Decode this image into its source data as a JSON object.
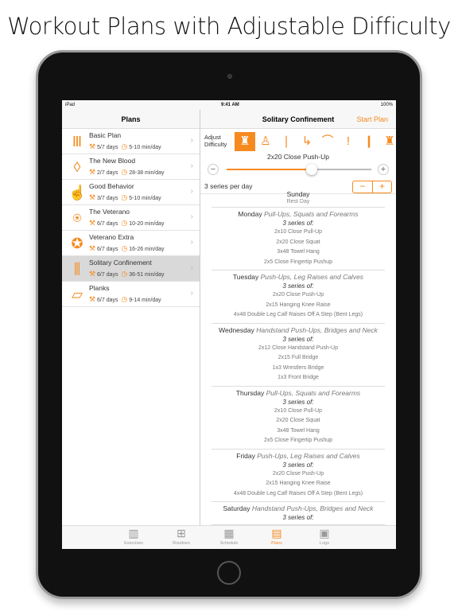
{
  "headline": "Workout Plans with Adjustable Difficulty",
  "status": {
    "device": "iPad",
    "time": "9:41 AM",
    "battery": "100%"
  },
  "left": {
    "title": "Plans",
    "plans": [
      {
        "name": "Basic Plan",
        "days": "5/7 days",
        "time": "5-10 min/day",
        "icon": "column-icon"
      },
      {
        "name": "The New Blood",
        "days": "2/7 days",
        "time": "28-38 min/day",
        "icon": "drop-icon"
      },
      {
        "name": "Good Behavior",
        "days": "3/7 days",
        "time": "5-10 min/day",
        "icon": "thumbs-up-icon"
      },
      {
        "name": "The Veterano",
        "days": "6/7 days",
        "time": "10-20 min/day",
        "icon": "medal-icon"
      },
      {
        "name": "Veterano Extra",
        "days": "6/7 days",
        "time": "16-26 min/day",
        "icon": "medal-stars-icon"
      },
      {
        "name": "Solitary Confinement",
        "days": "6/7 days",
        "time": "36-51 min/day",
        "icon": "bars-icon",
        "selected": true
      },
      {
        "name": "Planks",
        "days": "6/7 days",
        "time": "9-14 min/day",
        "icon": "plank-icon"
      }
    ]
  },
  "right": {
    "title": "Solitary Confinement",
    "start": "Start Plan",
    "adjust": "Adjust Difficulty",
    "exercise": "2x20 Close Push-Up",
    "slider_value": 0.59,
    "series": "3 series per day",
    "minus": "−",
    "plus": "+",
    "schedule": [
      {
        "day": "Sunday",
        "rest": "Rest Day"
      },
      {
        "day": "Monday",
        "focus": "Pull-Ups, Squats and Forearms",
        "sof": "3 series of:",
        "ex": [
          "2x10  Close Pull-Up",
          "2x20  Close Squat",
          "3x48  Towel Hang",
          "2x5  Close Fingertip Pushup"
        ]
      },
      {
        "day": "Tuesday",
        "focus": "Push-Ups, Leg Raises and Calves",
        "sof": "3 series of:",
        "ex": [
          "2x20  Close Push-Up",
          "2x15  Hanging Knee Raise",
          "4x48  Double Leg Calf Raises Off A Step (Bent Legs)"
        ]
      },
      {
        "day": "Wednesday",
        "focus": "Handstand Push-Ups, Bridges and Neck",
        "sof": "3 series of:",
        "ex": [
          "2x12  Close Handstand Push-Up",
          "2x15  Full Bridge",
          "1x3  Wrestlers Bridge",
          "1x3  Front Bridge"
        ]
      },
      {
        "day": "Thursday",
        "focus": "Pull-Ups, Squats and Forearms",
        "sof": "3 series of:",
        "ex": [
          "2x10  Close Pull-Up",
          "2x20  Close Squat",
          "3x48  Towel Hang",
          "2x5  Close Fingertip Pushup"
        ]
      },
      {
        "day": "Friday",
        "focus": "Push-Ups, Leg Raises and Calves",
        "sof": "3 series of:",
        "ex": [
          "2x20  Close Push-Up",
          "2x15  Hanging Knee Raise",
          "4x48  Double Leg Calf Raises Off A Step (Bent Legs)"
        ]
      },
      {
        "day": "Saturday",
        "focus": "Handstand Push-Ups, Bridges and Neck",
        "sof": "3 series of:",
        "ex": []
      }
    ]
  },
  "tabs": [
    {
      "label": "Exercises"
    },
    {
      "label": "Routines"
    },
    {
      "label": "Schedule"
    },
    {
      "label": "Plans",
      "active": true
    },
    {
      "label": "Logs"
    }
  ],
  "accent": "#f68a1f"
}
